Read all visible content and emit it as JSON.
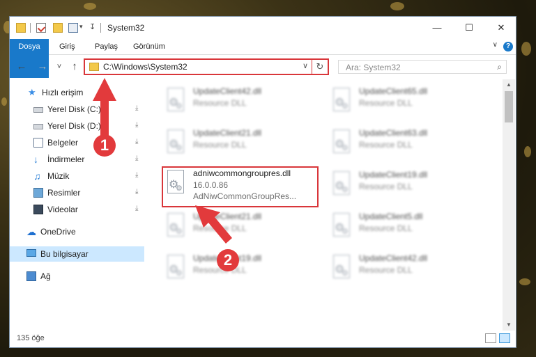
{
  "window": {
    "title": "System32",
    "min_glyph": "—",
    "max_glyph": "☐",
    "close_glyph": "✕"
  },
  "ribbon": {
    "tabs": [
      "Dosya",
      "Giriş",
      "Paylaş",
      "Görünüm"
    ],
    "collapse_glyph": "∨",
    "help_glyph": "?",
    "file_tab_color": "#1979ca"
  },
  "navigation": {
    "back_glyph": "←",
    "forward_glyph": "→",
    "recent_glyph": "˅",
    "up_glyph": "↑",
    "address": "C:\\Windows\\System32",
    "address_drop_glyph": "∨",
    "refresh_glyph": "↻",
    "search_placeholder": "Ara: System32",
    "search_glyph": "⌕"
  },
  "sidebar": {
    "quick_access": "Hızlı erişim",
    "pin_glyph": "📌",
    "items": [
      {
        "label": "Yerel Disk (C:)",
        "icon": "drive-icon"
      },
      {
        "label": "Yerel Disk (D:)",
        "icon": "drive-icon"
      },
      {
        "label": "Belgeler",
        "icon": "documents-icon"
      },
      {
        "label": "İndirmeler",
        "icon": "downloads-icon"
      },
      {
        "label": "Müzik",
        "icon": "music-icon"
      },
      {
        "label": "Resimler",
        "icon": "pictures-icon"
      },
      {
        "label": "Videolar",
        "icon": "videos-icon"
      }
    ],
    "onedrive": "OneDrive",
    "this_pc": "Bu bilgisayar",
    "network": "Ağ"
  },
  "files": {
    "highlighted": {
      "name": "adniwcommongroupres.dll",
      "version": "16.0.0.86",
      "description": "AdNiwCommonGroupRes..."
    },
    "left_column": [
      {
        "name": "UpdateClient42.dll",
        "desc": "Resource DLL"
      },
      {
        "name": "UpdateClient21.dll",
        "desc": "Resource DLL"
      },
      {
        "name": "UpdateClient21.dll",
        "desc": "Resource DLL"
      },
      {
        "name": "UpdateClient19.dll",
        "desc": "Resource DLL"
      }
    ],
    "right_column": [
      {
        "name": "UpdateClient65.dll",
        "desc": "Resource DLL"
      },
      {
        "name": "UpdateClient63.dll",
        "desc": "Resource DLL"
      },
      {
        "name": "UpdateClient19.dll",
        "desc": "Resource DLL"
      },
      {
        "name": "UpdateClient5.dll",
        "desc": "Resource DLL"
      },
      {
        "name": "UpdateClient42.dll",
        "desc": "Resource DLL"
      }
    ]
  },
  "status": {
    "item_count": "135 öğe"
  },
  "annotations": {
    "step1": "1",
    "step2": "2",
    "color": "#e23a3c"
  }
}
